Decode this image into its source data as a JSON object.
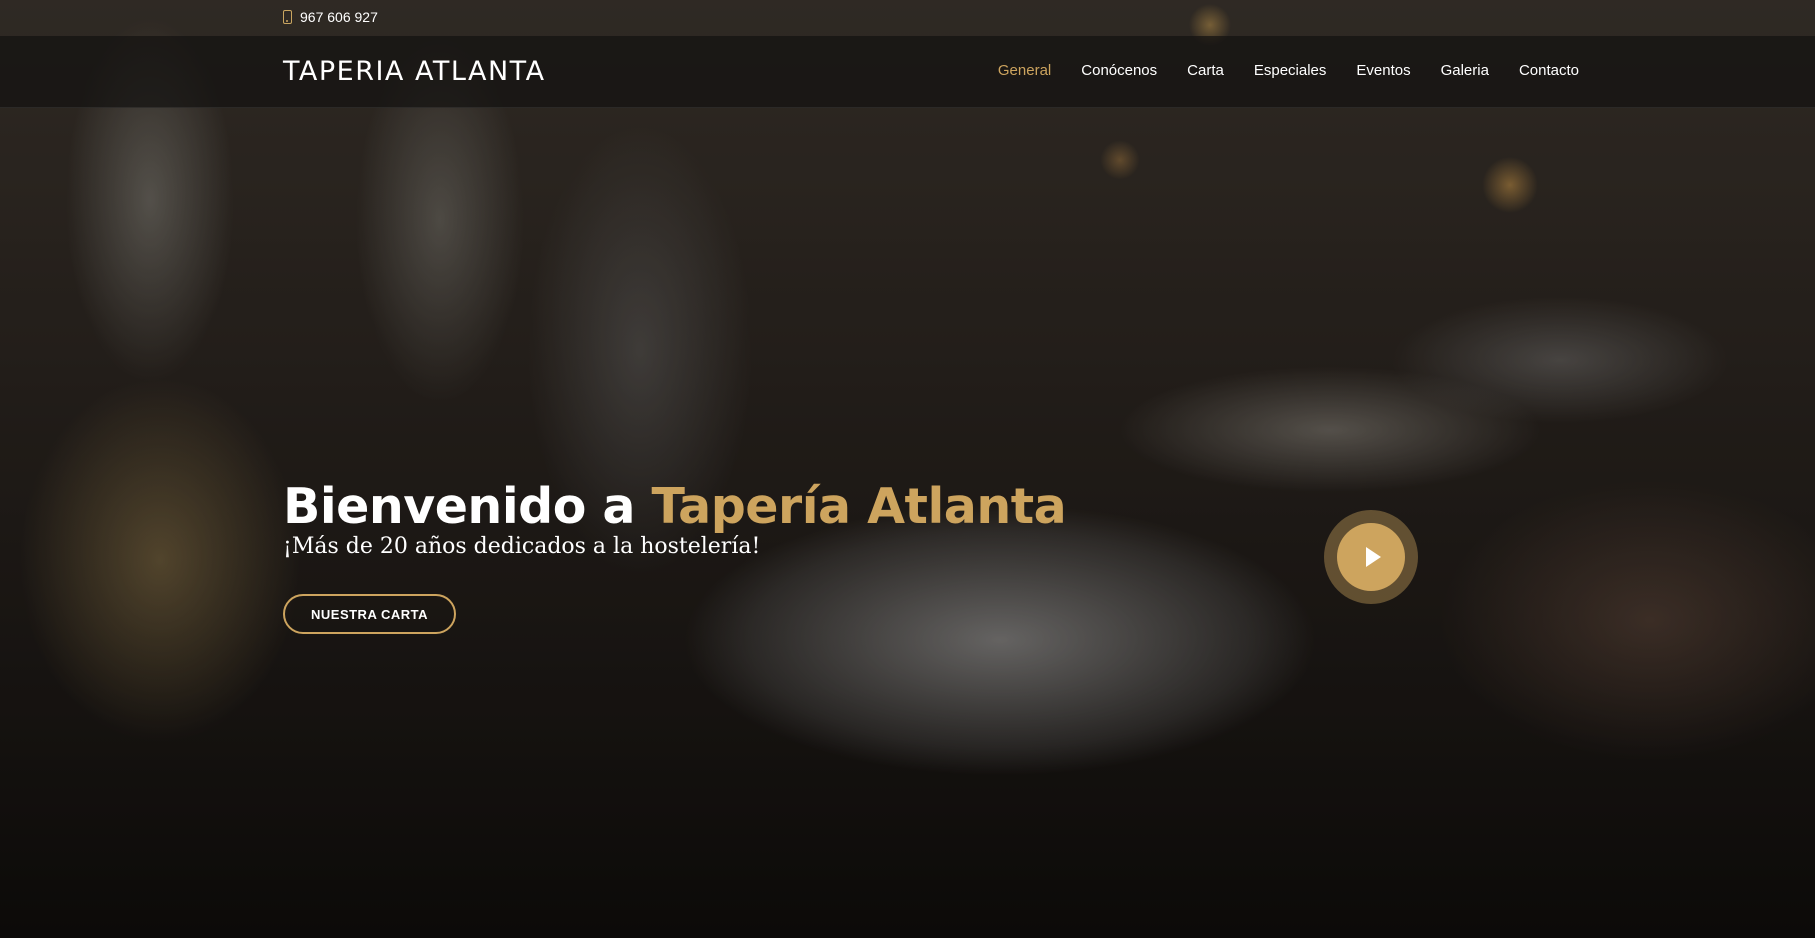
{
  "topbar": {
    "phone": "967 606 927",
    "phone_icon": "mobile-phone-icon"
  },
  "header": {
    "logo": "TAPERIA ATLANTA",
    "nav": [
      {
        "label": "General",
        "active": true
      },
      {
        "label": "Conócenos",
        "active": false
      },
      {
        "label": "Carta",
        "active": false
      },
      {
        "label": "Especiales",
        "active": false
      },
      {
        "label": "Eventos",
        "active": false
      },
      {
        "label": "Galeria",
        "active": false
      },
      {
        "label": "Contacto",
        "active": false
      }
    ]
  },
  "hero": {
    "title_prefix": "Bienvenido a ",
    "title_accent": "Tapería Atlanta",
    "subtitle": "¡Más de 20 años dedicados a la hostelería!",
    "cta_label": "NUESTRA CARTA",
    "play_icon": "play-icon"
  },
  "colors": {
    "accent": "#cda45e",
    "text": "#ffffff",
    "navbar_bg": "#141210"
  }
}
